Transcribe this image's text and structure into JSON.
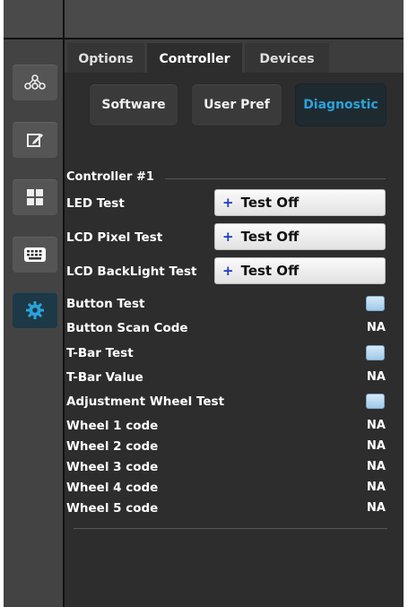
{
  "tabs": [
    {
      "label": "Options",
      "active": false
    },
    {
      "label": "Controller",
      "active": true
    },
    {
      "label": "Devices",
      "active": false
    }
  ],
  "subtabs": [
    {
      "label": "Software",
      "active": false
    },
    {
      "label": "User Pref",
      "active": false
    },
    {
      "label": "Diagnostic",
      "active": true
    }
  ],
  "sidebar": {
    "items": [
      {
        "icon": "network-icon",
        "active": false
      },
      {
        "icon": "edit-icon",
        "active": false
      },
      {
        "icon": "grid-icon",
        "active": false
      },
      {
        "icon": "keyboard-icon",
        "active": false
      },
      {
        "icon": "gear-icon",
        "active": true
      }
    ]
  },
  "section_title": "Controller #1",
  "tests": [
    {
      "label": "LED Test",
      "button": "Test Off"
    },
    {
      "label": "LCD Pixel Test",
      "button": "Test Off"
    },
    {
      "label": "LCD BackLight Test",
      "button": "Test Off"
    }
  ],
  "plus_glyph": "+",
  "rows": [
    {
      "label": "Button Test",
      "type": "checkbox"
    },
    {
      "label": "Button Scan Code",
      "type": "value",
      "value": "NA"
    },
    {
      "label": "T-Bar Test",
      "type": "checkbox"
    },
    {
      "label": "T-Bar Value",
      "type": "value",
      "value": "NA"
    },
    {
      "label": "Adjustment Wheel Test",
      "type": "checkbox"
    },
    {
      "label": "Wheel 1 code",
      "type": "value",
      "value": "NA"
    },
    {
      "label": "Wheel 2 code",
      "type": "value",
      "value": "NA"
    },
    {
      "label": "Wheel 3 code",
      "type": "value",
      "value": "NA"
    },
    {
      "label": "Wheel 4 code",
      "type": "value",
      "value": "NA"
    },
    {
      "label": "Wheel 5 code",
      "type": "value",
      "value": "NA"
    }
  ],
  "colors": {
    "accent": "#29a3d9",
    "background": "#2d2d2d",
    "button_plus": "#1a3cc8"
  }
}
